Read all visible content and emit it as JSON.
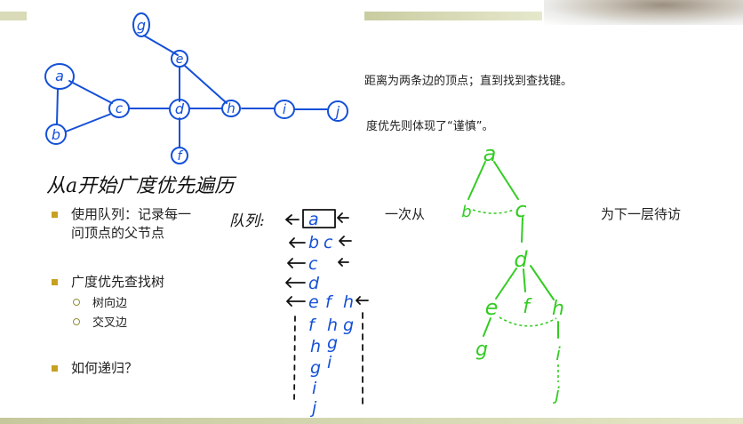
{
  "slide": {
    "line1_tail": "距离为两条边的顶点；直到找到查找键。",
    "line2_tail": "度优先则体现了“谨慎”。",
    "bullet1_head": "使用队列：记录每一",
    "bullet1_mid": "一次从",
    "bullet1_tail": "为下一层待访",
    "bullet1_line2": "问顶点的父节点",
    "bullet2": "广度优先查找树",
    "sub_tree_edge": "树向边",
    "sub_cross_edge": "交叉边",
    "bullet3": "如何递归？"
  },
  "handwriting": {
    "title": "从a开始广度优先遍历",
    "queue_label": "队列:",
    "graph_nodes": [
      "g",
      "e",
      "a",
      "c",
      "d",
      "h",
      "i",
      "j",
      "b",
      "f"
    ],
    "queue_rows": [
      [
        "a"
      ],
      [
        "b",
        "c"
      ],
      [
        "c"
      ],
      [
        "d"
      ],
      [
        "e",
        "f",
        "h"
      ],
      [
        "f",
        "h",
        "g"
      ],
      [
        "h",
        "g"
      ],
      [
        "g",
        "i"
      ],
      [
        "i"
      ],
      [
        "j"
      ]
    ],
    "tree_nodes": [
      "a",
      "b",
      "c",
      "d",
      "e",
      "f",
      "h",
      "g",
      "i",
      "j"
    ]
  },
  "colors": {
    "accent_bar": "#c9cca0",
    "bullet": "#c8a020",
    "ink_blue": "#1450d8",
    "ink_green": "#33cc22",
    "ink_black": "#111111"
  }
}
